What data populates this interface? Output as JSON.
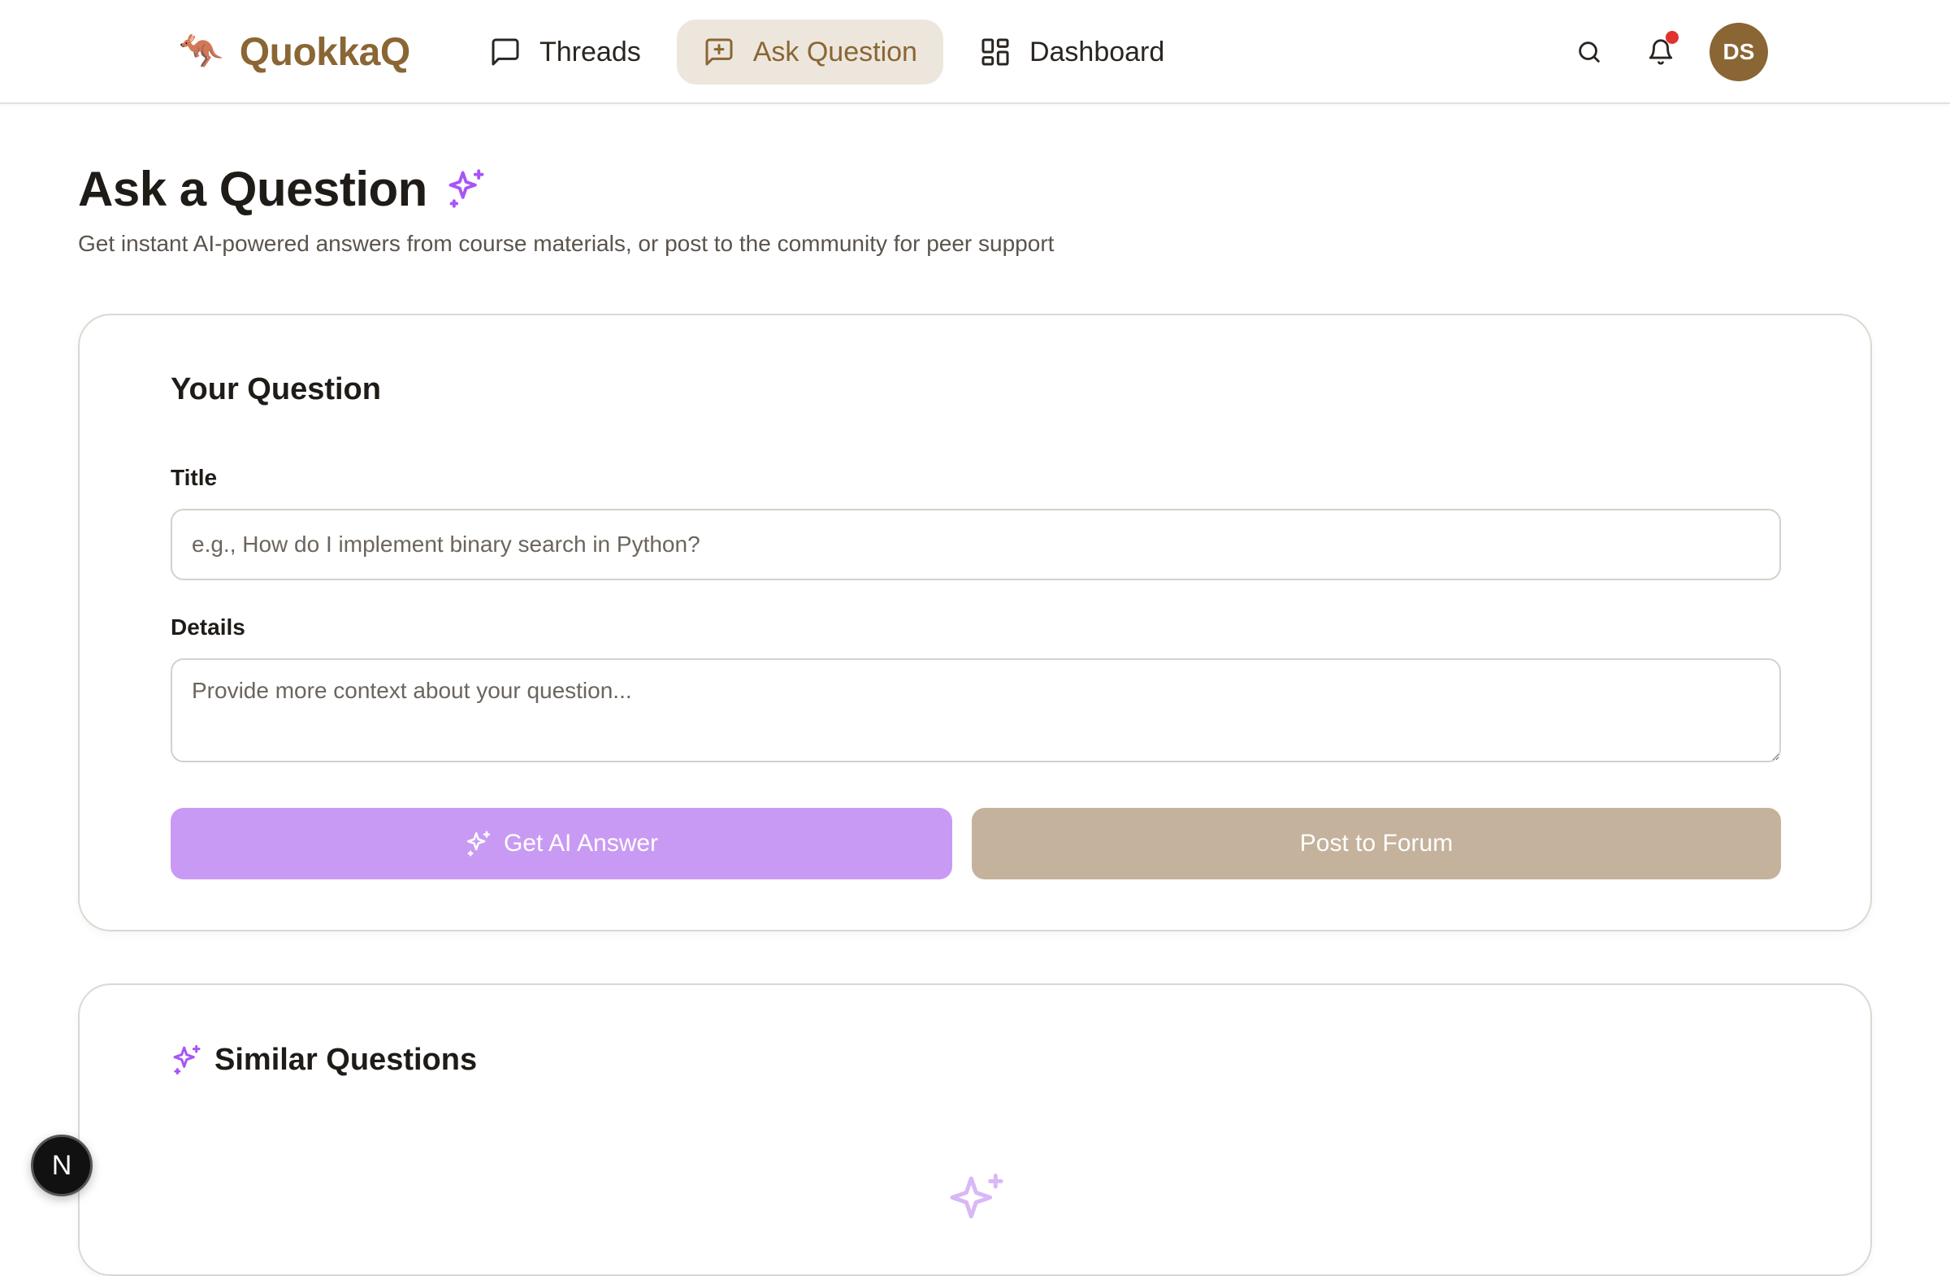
{
  "brand": {
    "logo": "🦘",
    "name": "QuokkaQ"
  },
  "nav": {
    "items": [
      {
        "label": "Threads",
        "icon": "message-square-icon"
      },
      {
        "label": "Ask Question",
        "icon": "message-square-plus-icon",
        "active": true
      },
      {
        "label": "Dashboard",
        "icon": "layout-dashboard-icon"
      }
    ]
  },
  "header_icons": {
    "search": "search-icon",
    "notifications": "bell-icon",
    "notification_dot": true
  },
  "user": {
    "initials": "DS"
  },
  "page": {
    "title": "Ask a Question",
    "subtitle": "Get instant AI-powered answers from course materials, or post to the community for peer support"
  },
  "question_form": {
    "heading": "Your Question",
    "title_label": "Title",
    "title_value": "",
    "title_placeholder": "e.g., How do I implement binary search in Python?",
    "details_label": "Details",
    "details_value": "",
    "details_placeholder": "Provide more context about your question...",
    "ai_button": "Get AI Answer",
    "forum_button": "Post to Forum"
  },
  "similar": {
    "heading": "Similar Questions"
  },
  "floating_badge": {
    "label": "N"
  },
  "colors": {
    "brand": "#8a6634",
    "nav_active_bg": "#ede6dd",
    "ai_accent": "#a855f7",
    "ai_button": "#c99af3",
    "forum_button": "#c4b29c",
    "notification": "#e0332f"
  }
}
